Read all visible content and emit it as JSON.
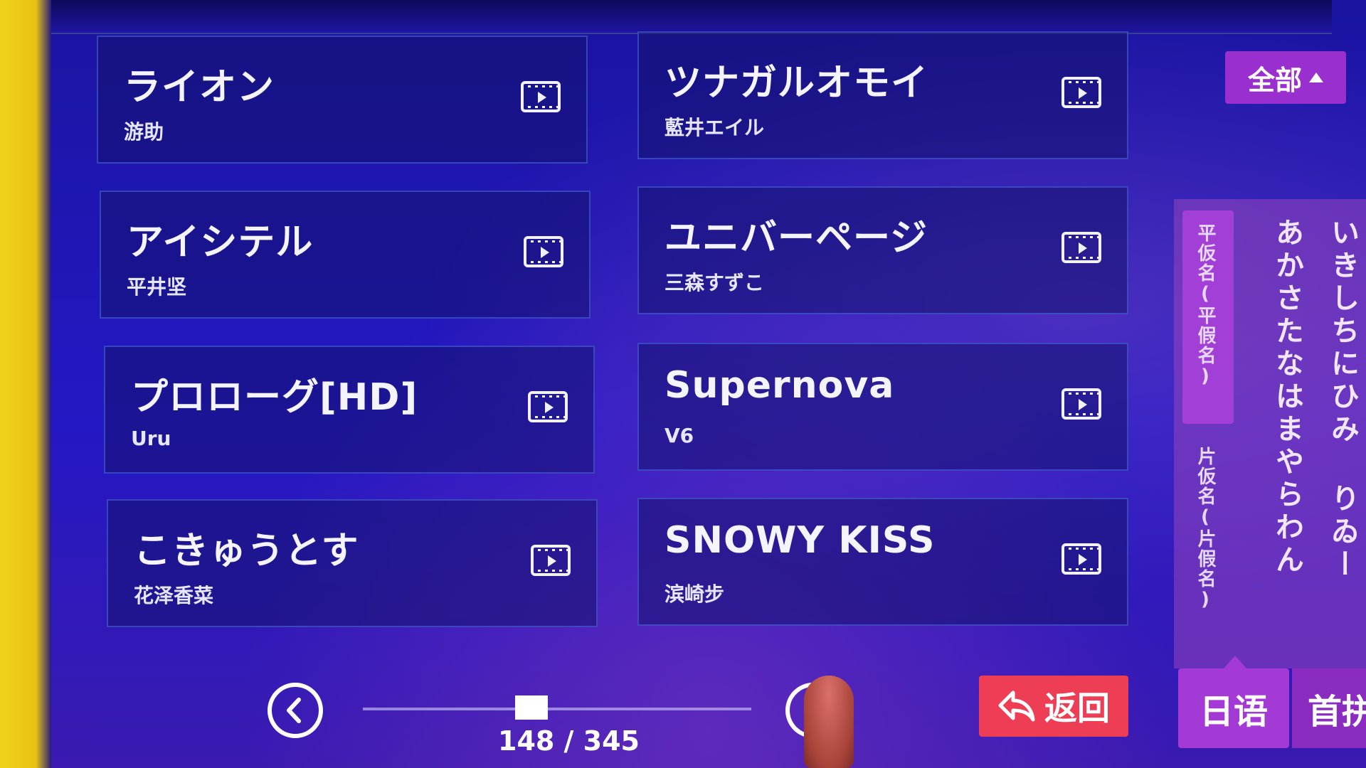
{
  "songs": [
    {
      "title": "ライオン",
      "artist": "游助"
    },
    {
      "title": "ツナガルオモイ",
      "artist": "藍井エイル"
    },
    {
      "title": "アイシテル",
      "artist": "平井坚"
    },
    {
      "title": "ユニバーページ",
      "artist": "三森すずこ"
    },
    {
      "title": "プロローグ[HD]",
      "artist": "Uru"
    },
    {
      "title": "Supernova",
      "artist": "V6"
    },
    {
      "title": "こきゅうとす",
      "artist": "花泽香菜"
    },
    {
      "title": "SNOWY KISS",
      "artist": "滨崎步"
    }
  ],
  "filter": {
    "all_label": "全部"
  },
  "kana": {
    "hiragana_tab": "平仮名(平假名)",
    "katakana_tab": "片仮名(片假名)",
    "column_1": "あかさたなはまやらわん",
    "column_2": "いきしちにひみ りゐー"
  },
  "pagination": {
    "counter": "148 / 345",
    "current": 148,
    "total": 345
  },
  "buttons": {
    "back_label": "返回"
  },
  "language": {
    "current": "日语",
    "next": "首拼"
  },
  "colors": {
    "accent": "#9a2fd0",
    "back": "#ee3e55",
    "background": "#1c0fa0"
  }
}
